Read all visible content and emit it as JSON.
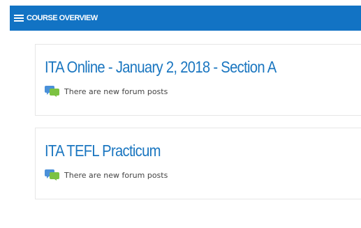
{
  "header": {
    "menu_icon": "hamburger-menu-icon",
    "title": "COURSE OVERVIEW"
  },
  "courses": [
    {
      "title": "ITA Online - January 2, 2018 - Section A",
      "notice_icon": "forum-posts-icon",
      "notice": "There are new forum posts"
    },
    {
      "title": "ITA TEFL Practicum",
      "notice_icon": "forum-posts-icon",
      "notice": "There are new forum posts"
    }
  ],
  "colors": {
    "header_bg": "#1273c4",
    "link": "#1a76c0",
    "forum_icon_blue": "#4a90d9",
    "forum_icon_green": "#7cc242"
  }
}
